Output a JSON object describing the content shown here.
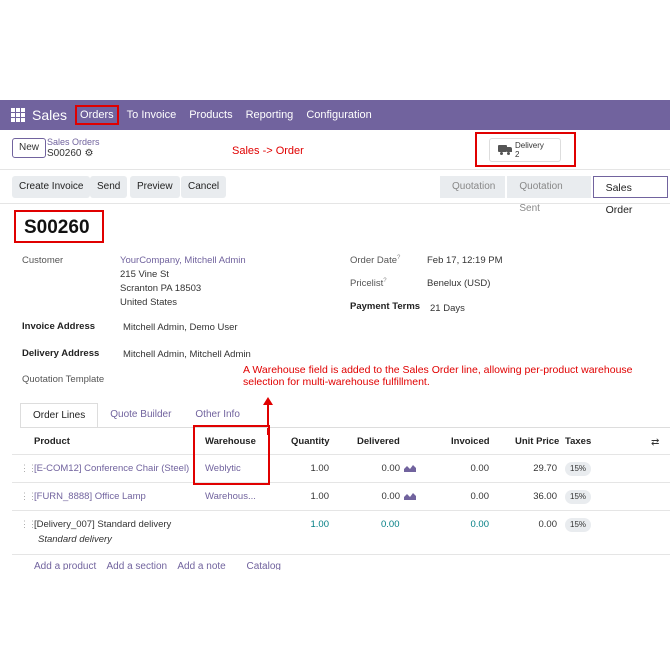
{
  "topnav": {
    "brand": "Sales",
    "items": [
      "Orders",
      "To Invoice",
      "Products",
      "Reporting",
      "Configuration"
    ]
  },
  "breadcrumb": {
    "new_label": "New",
    "parent": "Sales Orders",
    "current": "S00260",
    "annotation": "Sales -> Order"
  },
  "smart_button": {
    "label": "Delivery",
    "count": "2"
  },
  "actions": [
    "Create Invoice",
    "Send",
    "Preview",
    "Cancel"
  ],
  "statusbar": [
    "Quotation",
    "Quotation Sent",
    "Sales Order"
  ],
  "form": {
    "title": "S00260",
    "customer_label": "Customer",
    "customer_name": "YourCompany, Mitchell Admin",
    "address1": "215 Vine St",
    "address2": "Scranton PA 18503",
    "address3": "United States",
    "invoice_address_label": "Invoice Address",
    "invoice_address": "Mitchell Admin, Demo User",
    "delivery_address_label": "Delivery Address",
    "delivery_address": "Mitchell Admin, Mitchell Admin",
    "quotation_template_label": "Quotation Template",
    "order_date_label": "Order Date",
    "order_date": "Feb 17, 12:19 PM",
    "pricelist_label": "Pricelist",
    "pricelist": "Benelux (USD)",
    "payment_terms_label": "Payment Terms",
    "payment_terms": "21 Days",
    "help_mark": "?"
  },
  "annotation_mid": "A Warehouse field is added to the Sales Order line, allowing per-product warehouse selection for multi-warehouse fulfillment.",
  "tabs": [
    "Order Lines",
    "Quote Builder",
    "Other Info"
  ],
  "table": {
    "headers": [
      "Product",
      "Warehouse",
      "Quantity",
      "Delivered",
      "Invoiced",
      "Unit Price",
      "Taxes"
    ],
    "rows": [
      {
        "product": "[E-COM12] Conference Chair (Steel)",
        "warehouse": "Weblytic",
        "quantity": "1.00",
        "delivered": "0.00",
        "invoiced": "0.00",
        "unit_price": "29.70",
        "tax": "15%"
      },
      {
        "product": "[FURN_8888] Office Lamp",
        "warehouse": "Warehous...",
        "quantity": "1.00",
        "delivered": "0.00",
        "invoiced": "0.00",
        "unit_price": "36.00",
        "tax": "15%"
      },
      {
        "product": "[Delivery_007] Standard delivery",
        "description": "Standard delivery",
        "warehouse": "",
        "quantity": "1.00",
        "delivered": "0.00",
        "invoiced": "0.00",
        "unit_price": "0.00",
        "tax": "15%"
      }
    ],
    "add_links": [
      "Add a product",
      "Add a section",
      "Add a note",
      "Catalog"
    ]
  },
  "colors": {
    "brand": "#71639e",
    "annotation": "#e00000",
    "teal": "#017e84"
  },
  "icons": [
    "apps-grid-icon",
    "gear-icon",
    "truck-icon",
    "chart-icon",
    "drag-handle-icon",
    "column-settings-icon"
  ]
}
